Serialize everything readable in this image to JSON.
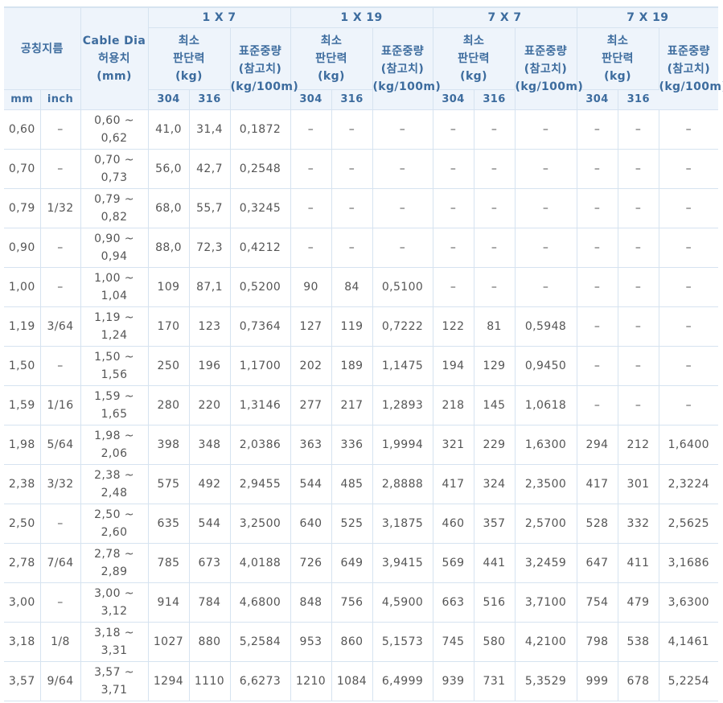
{
  "headers": {
    "nominal": "공칭지름",
    "mm": "mm",
    "inch": "inch",
    "cable_dia": [
      "Cable Dia",
      "허용치",
      "(mm)"
    ],
    "groups": [
      "1 X 7",
      "1 X 19",
      "7 X 7",
      "7 X 19"
    ],
    "strength": [
      "최소",
      "판단력",
      "(kg)"
    ],
    "weight": [
      "표준중량",
      "(참고치)",
      "(kg/100m)"
    ],
    "g304": "304",
    "g316": "316"
  },
  "rows": [
    {
      "mm": "0,60",
      "inch": "–",
      "dia": [
        "0,60 ~",
        "0,62"
      ],
      "vals": [
        "41,0",
        "31,4",
        "0,1872",
        "–",
        "–",
        "–",
        "–",
        "–",
        "–",
        "–",
        "–",
        "–"
      ]
    },
    {
      "mm": "0,70",
      "inch": "–",
      "dia": [
        "0,70 ~",
        "0,73"
      ],
      "vals": [
        "56,0",
        "42,7",
        "0,2548",
        "–",
        "–",
        "–",
        "–",
        "–",
        "–",
        "–",
        "–",
        "–"
      ]
    },
    {
      "mm": "0,79",
      "inch": "1/32",
      "dia": [
        "0,79 ~",
        "0,82"
      ],
      "vals": [
        "68,0",
        "55,7",
        "0,3245",
        "–",
        "–",
        "–",
        "–",
        "–",
        "–",
        "–",
        "–",
        "–"
      ]
    },
    {
      "mm": "0,90",
      "inch": "–",
      "dia": [
        "0,90 ~",
        "0,94"
      ],
      "vals": [
        "88,0",
        "72,3",
        "0,4212",
        "–",
        "–",
        "–",
        "–",
        "–",
        "–",
        "–",
        "–",
        "–"
      ]
    },
    {
      "mm": "1,00",
      "inch": "–",
      "dia": [
        "1,00 ~",
        "1,04"
      ],
      "vals": [
        "109",
        "87,1",
        "0,5200",
        "90",
        "84",
        "0,5100",
        "–",
        "–",
        "–",
        "–",
        "–",
        "–"
      ]
    },
    {
      "mm": "1,19",
      "inch": "3/64",
      "dia": [
        "1,19 ~",
        "1,24"
      ],
      "vals": [
        "170",
        "123",
        "0,7364",
        "127",
        "119",
        "0,7222",
        "122",
        "81",
        "0,5948",
        "–",
        "–",
        "–"
      ]
    },
    {
      "mm": "1,50",
      "inch": "–",
      "dia": [
        "1,50 ~",
        "1,56"
      ],
      "vals": [
        "250",
        "196",
        "1,1700",
        "202",
        "189",
        "1,1475",
        "194",
        "129",
        "0,9450",
        "–",
        "–",
        "–"
      ]
    },
    {
      "mm": "1,59",
      "inch": "1/16",
      "dia": [
        "1,59 ~",
        "1,65"
      ],
      "vals": [
        "280",
        "220",
        "1,3146",
        "277",
        "217",
        "1,2893",
        "218",
        "145",
        "1,0618",
        "–",
        "–",
        "–"
      ]
    },
    {
      "mm": "1,98",
      "inch": "5/64",
      "dia": [
        "1,98 ~",
        "2,06"
      ],
      "vals": [
        "398",
        "348",
        "2,0386",
        "363",
        "336",
        "1,9994",
        "321",
        "229",
        "1,6300",
        "294",
        "212",
        "1,6400"
      ]
    },
    {
      "mm": "2,38",
      "inch": "3/32",
      "dia": [
        "2,38 ~",
        "2,48"
      ],
      "vals": [
        "575",
        "492",
        "2,9455",
        "544",
        "485",
        "2,8888",
        "417",
        "324",
        "2,3500",
        "417",
        "301",
        "2,3224"
      ]
    },
    {
      "mm": "2,50",
      "inch": "–",
      "dia": [
        "2,50 ~",
        "2,60"
      ],
      "vals": [
        "635",
        "544",
        "3,2500",
        "640",
        "525",
        "3,1875",
        "460",
        "357",
        "2,5700",
        "528",
        "332",
        "2,5625"
      ]
    },
    {
      "mm": "2,78",
      "inch": "7/64",
      "dia": [
        "2,78 ~",
        "2,89"
      ],
      "vals": [
        "785",
        "673",
        "4,0188",
        "726",
        "649",
        "3,9415",
        "569",
        "441",
        "3,2459",
        "647",
        "411",
        "3,1686"
      ]
    },
    {
      "mm": "3,00",
      "inch": "–",
      "dia": [
        "3,00 ~",
        "3,12"
      ],
      "vals": [
        "914",
        "784",
        "4,6800",
        "848",
        "756",
        "4,5900",
        "663",
        "516",
        "3,7100",
        "754",
        "479",
        "3,6300"
      ]
    },
    {
      "mm": "3,18",
      "inch": "1/8",
      "dia": [
        "3,18 ~",
        "3,31"
      ],
      "vals": [
        "1027",
        "880",
        "5,2584",
        "953",
        "860",
        "5,1573",
        "745",
        "580",
        "4,2100",
        "798",
        "538",
        "4,1461"
      ]
    },
    {
      "mm": "3,57",
      "inch": "9/64",
      "dia": [
        "3,57 ~",
        "3,71"
      ],
      "vals": [
        "1294",
        "1110",
        "6,6273",
        "1210",
        "1084",
        "6,4999",
        "939",
        "731",
        "5,3529",
        "999",
        "678",
        "5,2254"
      ]
    }
  ]
}
